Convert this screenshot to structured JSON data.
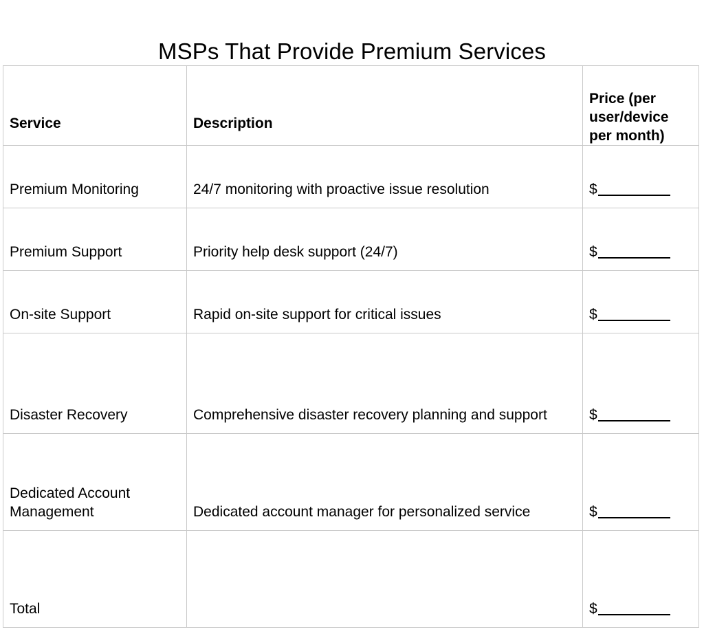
{
  "document": {
    "title": "MSPs That Provide Premium Services",
    "background_color": "#ffffff",
    "text_color": "#000000",
    "border_color": "#c9c9c9"
  },
  "table": {
    "columns": [
      {
        "key": "service",
        "label": "Service"
      },
      {
        "key": "description",
        "label": "Description"
      },
      {
        "key": "price",
        "label": "Price (per user/device per month)"
      }
    ],
    "price_header_lines": [
      "Price (per",
      "user/device",
      "per month)"
    ],
    "price_currency_symbol": "$",
    "price_blank_value": "",
    "rows": [
      {
        "service": "Premium Monitoring",
        "description": "24/7 monitoring with proactive issue resolution",
        "price": "$"
      },
      {
        "service": "Premium Support",
        "description": "Priority help desk support (24/7)",
        "price": "$"
      },
      {
        "service": "On-site Support",
        "description": "Rapid on-site support for critical issues",
        "price": "$"
      },
      {
        "service": "Disaster Recovery",
        "description": "Comprehensive disaster recovery planning and support",
        "price": "$"
      },
      {
        "service": "Dedicated Account Management",
        "description": "Dedicated account manager for personalized service",
        "price": "$"
      },
      {
        "service": "Total",
        "description": "",
        "price": "$"
      }
    ]
  }
}
